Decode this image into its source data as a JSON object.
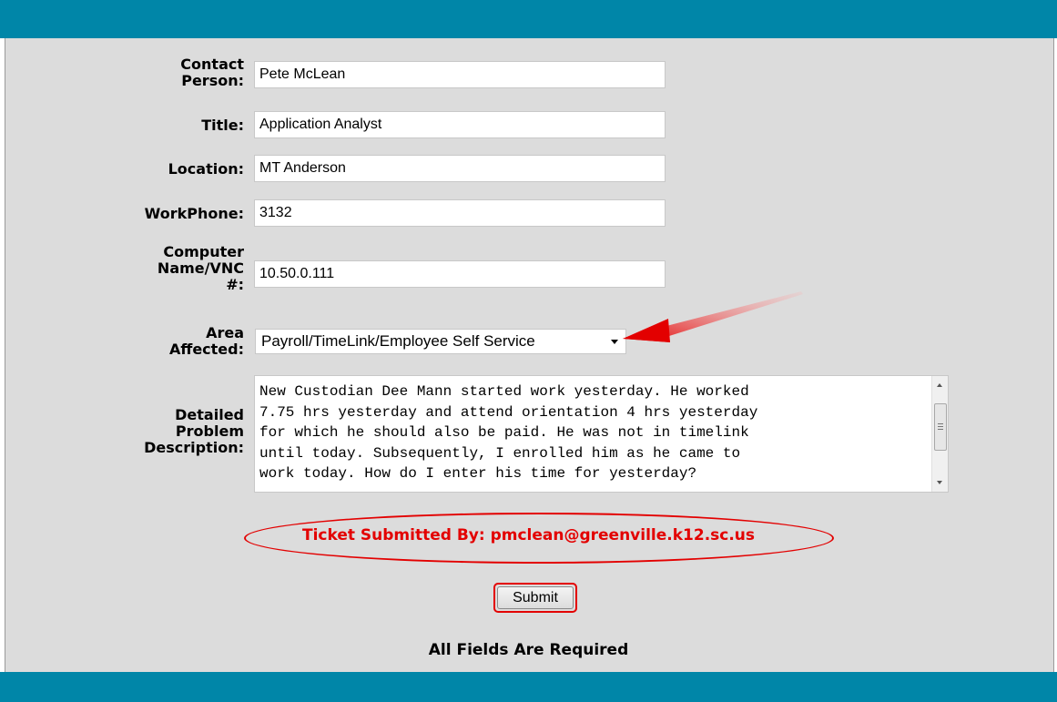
{
  "form": {
    "contact_label": [
      "Contact",
      "Person:"
    ],
    "contact_value": "Pete McLean",
    "title_label": "Title:",
    "title_value": "Application Analyst",
    "location_label": "Location:",
    "location_value": "MT Anderson",
    "workphone_label": "WorkPhone:",
    "workphone_value": "3132",
    "computer_label": [
      "Computer",
      "Name/VNC",
      "#:"
    ],
    "computer_value": "10.50.0.111",
    "area_label": [
      "Area",
      "Affected:"
    ],
    "area_selected": "Payroll/TimeLink/Employee Self Service",
    "description_label": [
      "Detailed",
      "Problem",
      "Description:"
    ],
    "description_value": "New Custodian Dee Mann started work yesterday. He worked\n7.75 hrs yesterday and attend orientation 4 hrs yesterday\nfor which he should also be paid. He was not in timelink\nuntil today. Subsequently, I enrolled him as he came to\nwork today. How do I enter his time for yesterday?",
    "submitted_by": "Ticket Submitted By: pmclean@greenville.k12.sc.us",
    "submit_label": "Submit",
    "required_note": "All Fields Are Required"
  },
  "colors": {
    "header_band": "#0086a8",
    "background": "#dcdcdc",
    "annotation_red": "#e30000"
  }
}
